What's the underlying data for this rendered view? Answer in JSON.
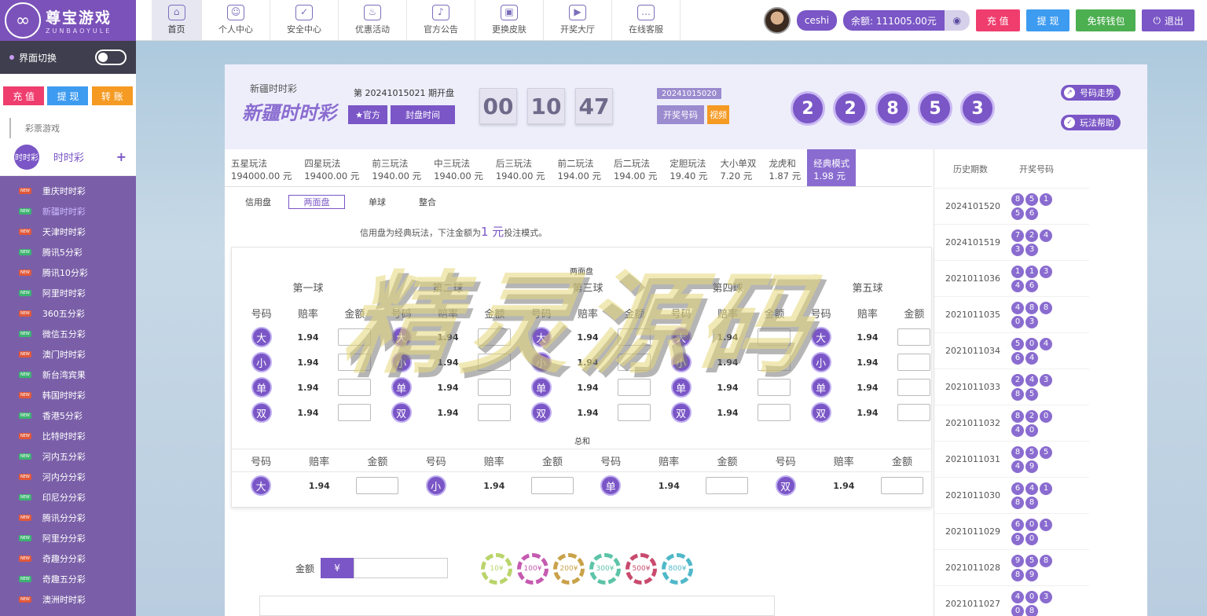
{
  "brand": {
    "title": "尊宝游戏",
    "subtitle": "ZUNBAOYULE"
  },
  "nav": [
    {
      "label": "首页",
      "icon": "home-icon"
    },
    {
      "label": "个人中心",
      "icon": "user-icon"
    },
    {
      "label": "安全中心",
      "icon": "shield-icon"
    },
    {
      "label": "优惠活动",
      "icon": "fire-icon"
    },
    {
      "label": "官方公告",
      "icon": "speaker-icon"
    },
    {
      "label": "更换皮肤",
      "icon": "image-icon"
    },
    {
      "label": "开奖大厅",
      "icon": "video-icon"
    },
    {
      "label": "在线客服",
      "icon": "chat-icon"
    }
  ],
  "user": {
    "name": "ceshi",
    "balance": "余额: 111005.00元",
    "recharge": "充 值",
    "withdraw": "提 现",
    "free_wallet": "免转钱包",
    "logout": "退出"
  },
  "colors": {
    "purple": "#7a56c6",
    "recharge": "#ef3d6e",
    "withdraw": "#3d9bf0",
    "freewallet": "#4caf50",
    "transfer": "#f59a23"
  },
  "sidebar": {
    "switch_label": "界面切换",
    "buttons": [
      "充 值",
      "提 现",
      "转 账"
    ],
    "category": "彩票游戏",
    "lottery": "时时彩",
    "lottery_logo": "时时彩",
    "games": [
      "重庆时时彩",
      "新疆时时彩",
      "天津时时彩",
      "腾讯5分彩",
      "腾讯10分彩",
      "阿里时时彩",
      "360五分彩",
      "微信五分彩",
      "澳门时时彩",
      "新台湾宾果",
      "韩国时时彩",
      "香港5分彩",
      "比特时时彩",
      "河内五分彩",
      "河内分分彩",
      "印尼分分彩",
      "腾讯分分彩",
      "阿里分分彩",
      "奇趣分分彩",
      "奇趣五分彩",
      "澳洲时时彩"
    ],
    "badge": "NEW"
  },
  "lottery": {
    "name": "新疆时时彩",
    "logo_text": "新疆时时彩",
    "issue": "第 20241015021 期开盘",
    "official": "★官方",
    "close_time": "封盘时间",
    "countdown": [
      "00",
      "10",
      "47"
    ],
    "prev_issue": "20241015020",
    "draw_numbers_btn": "开奖号码",
    "video_btn": "视频",
    "result": [
      "2",
      "2",
      "8",
      "5",
      "3"
    ],
    "trend_btn": "号码走势",
    "help_btn": "玩法帮助"
  },
  "tabs": [
    {
      "name": "五星玩法",
      "odds": "194000.00 元"
    },
    {
      "name": "四星玩法",
      "odds": "19400.00 元"
    },
    {
      "name": "前三玩法",
      "odds": "1940.00 元"
    },
    {
      "name": "中三玩法",
      "odds": "1940.00 元"
    },
    {
      "name": "后三玩法",
      "odds": "1940.00 元"
    },
    {
      "name": "前二玩法",
      "odds": "194.00 元"
    },
    {
      "name": "后二玩法",
      "odds": "194.00 元"
    },
    {
      "name": "定胆玩法",
      "odds": "19.40 元"
    },
    {
      "name": "大小单双",
      "odds": "7.20 元"
    },
    {
      "name": "龙虎和",
      "odds": "1.87 元"
    },
    {
      "name": "经典模式",
      "odds": "1.98 元"
    }
  ],
  "subtabs": {
    "credit": "信用盘",
    "two_sides": "两面盘",
    "single": "单球",
    "combo": "整合"
  },
  "note": {
    "pre": "信用盘为经典玩法，下注金额为",
    "amount": "1 元",
    "post": "投注模式。"
  },
  "board": {
    "title": "两面盘",
    "balls": [
      "第一球",
      "第二球",
      "第三球",
      "第四球",
      "第五球"
    ],
    "col_headers": [
      "号码",
      "赔率",
      "金额"
    ],
    "options": [
      "大",
      "小",
      "单",
      "双"
    ],
    "odds": "1.94",
    "sum_title": "总和"
  },
  "bet": {
    "label": "金额",
    "currency": "¥"
  },
  "chips": [
    "10¥",
    "100¥",
    "200¥",
    "300¥",
    "500¥",
    "800¥"
  ],
  "chip_colors": [
    "#b9d46a",
    "#c55ab0",
    "#c9a24a",
    "#5cc4a8",
    "#c84b6e",
    "#4fb8c9"
  ],
  "history": {
    "col_issue": "历史期数",
    "col_numbers": "开奖号码",
    "rows": [
      {
        "issue": "2024101520",
        "nums": [
          "8",
          "5",
          "1",
          "5",
          "6"
        ]
      },
      {
        "issue": "2024101519",
        "nums": [
          "7",
          "2",
          "4",
          "3",
          "3"
        ]
      },
      {
        "issue": "2021011036",
        "nums": [
          "1",
          "1",
          "3",
          "4",
          "6"
        ]
      },
      {
        "issue": "2021011035",
        "nums": [
          "4",
          "8",
          "8",
          "0",
          "3"
        ]
      },
      {
        "issue": "2021011034",
        "nums": [
          "5",
          "0",
          "4",
          "6",
          "4"
        ]
      },
      {
        "issue": "2021011033",
        "nums": [
          "2",
          "4",
          "3",
          "8",
          "5"
        ]
      },
      {
        "issue": "2021011032",
        "nums": [
          "8",
          "2",
          "0",
          "4",
          "0"
        ]
      },
      {
        "issue": "2021011031",
        "nums": [
          "8",
          "5",
          "5",
          "4",
          "9"
        ]
      },
      {
        "issue": "2021011030",
        "nums": [
          "6",
          "4",
          "1",
          "8",
          "8"
        ]
      },
      {
        "issue": "2021011029",
        "nums": [
          "6",
          "0",
          "1",
          "9",
          "0"
        ]
      },
      {
        "issue": "2021011028",
        "nums": [
          "9",
          "5",
          "8",
          "8",
          "9"
        ]
      },
      {
        "issue": "2021011027",
        "nums": [
          "4",
          "0",
          "3",
          "0",
          "8"
        ]
      }
    ]
  },
  "watermark": "精灵源码"
}
